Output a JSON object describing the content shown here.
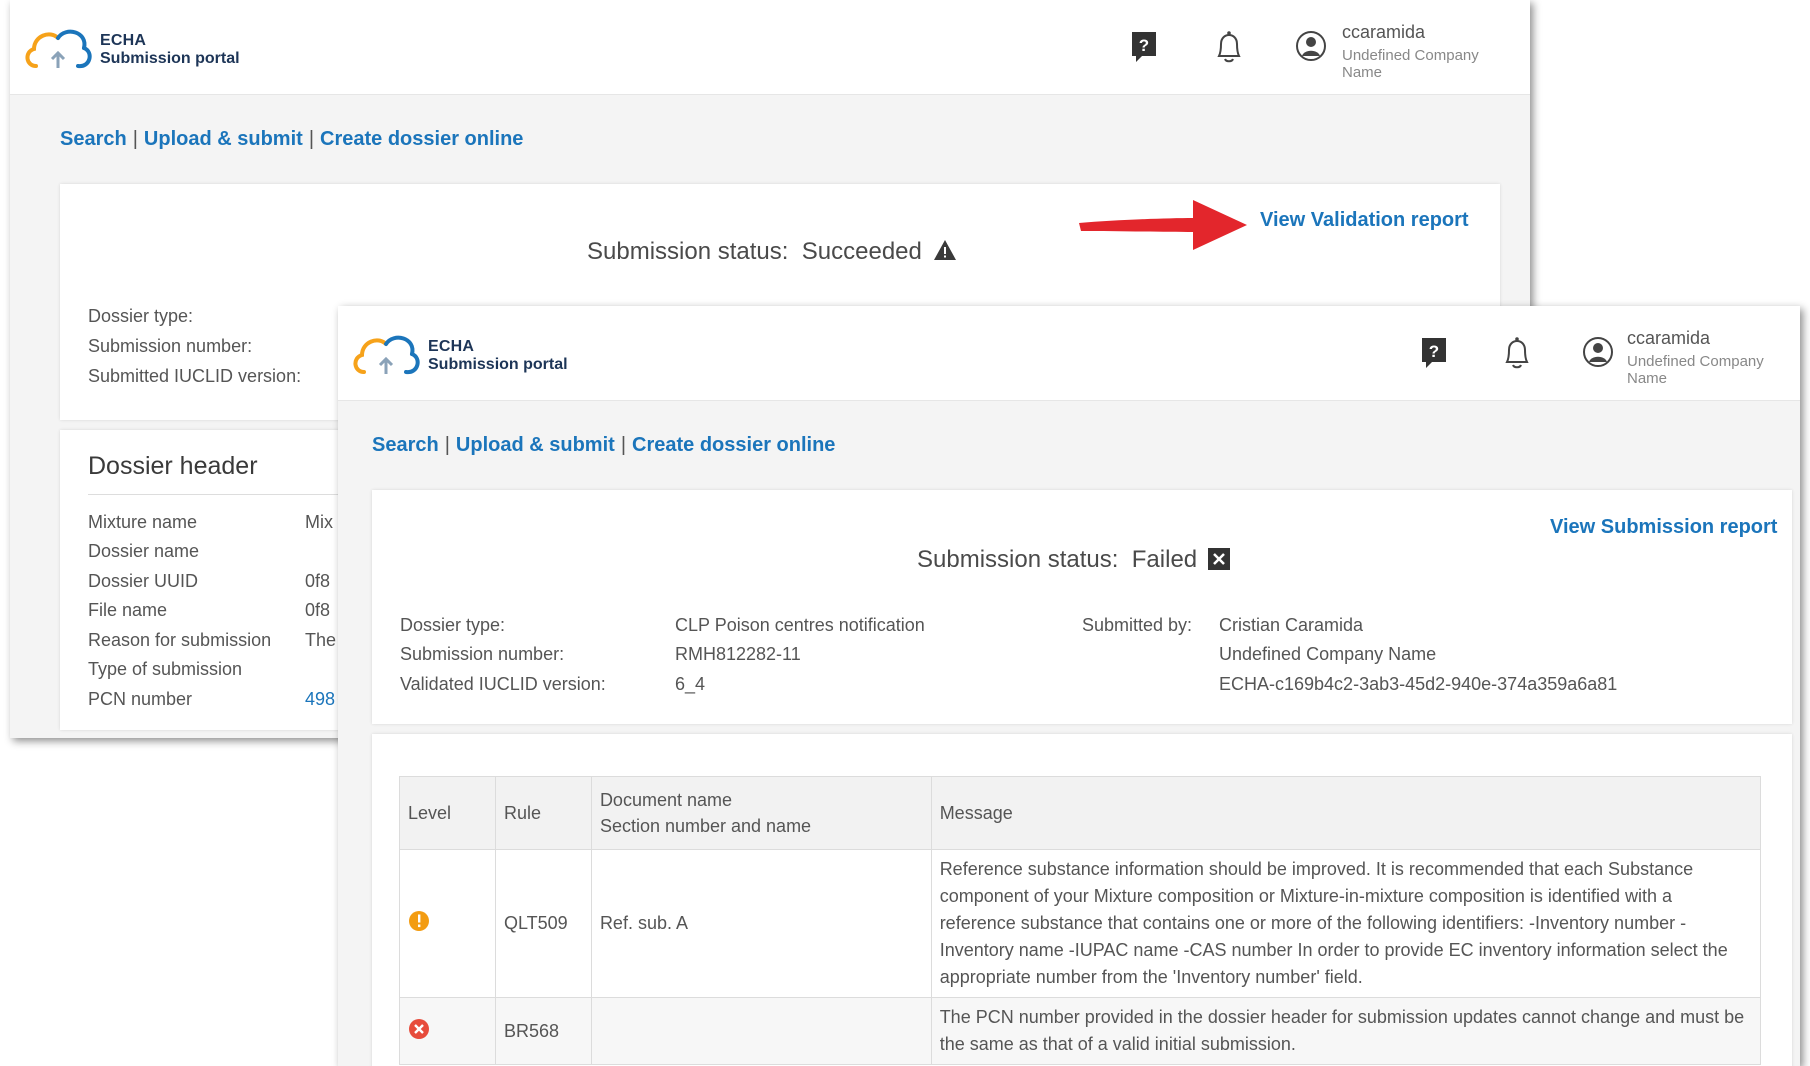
{
  "app": {
    "logo_line1": "ECHA",
    "logo_line2": "Submission portal"
  },
  "user": {
    "username": "ccaramida",
    "company_line1": "Undefined Company",
    "company_line2": "Name"
  },
  "nav": {
    "search": "Search",
    "upload_submit": "Upload & submit",
    "create_dossier": "Create dossier online",
    "separator": "|"
  },
  "window1": {
    "view_validation_report": "View Validation report",
    "status_label": "Submission status:",
    "status_value": "Succeeded",
    "summary_labels": [
      "Dossier type:",
      "Submission number:",
      "Submitted IUCLID version:"
    ],
    "dossier_header": {
      "title": "Dossier header",
      "rows": [
        {
          "label": "Mixture name",
          "value": "Mix"
        },
        {
          "label": "Dossier name",
          "value": ""
        },
        {
          "label": "Dossier UUID",
          "value": "0f8"
        },
        {
          "label": "File name",
          "value": "0f8"
        },
        {
          "label": "Reason for submission",
          "value": "The"
        },
        {
          "label": "Type of submission",
          "value": ""
        },
        {
          "label": "PCN number",
          "value": "498"
        }
      ]
    }
  },
  "window2": {
    "view_submission_report": "View Submission report",
    "status_label": "Submission status:",
    "status_value": "Failed",
    "summary": {
      "dossier_type_label": "Dossier type:",
      "dossier_type_value": "CLP Poison centres notification",
      "submission_number_label": "Submission number:",
      "submission_number_value": "RMH812282-11",
      "iuclid_label": "Validated IUCLID version:",
      "iuclid_value": "6_4",
      "submitted_by_label": "Submitted by:",
      "submitted_by_name": "Cristian Caramida",
      "submitted_by_company": "Undefined Company Name",
      "submitted_by_id": "ECHA-c169b4c2-3ab3-45d2-940e-374a359a6a81"
    },
    "table": {
      "headers": {
        "level": "Level",
        "rule": "Rule",
        "document_line1": "Document name",
        "document_line2": "Section number and name",
        "message": "Message"
      },
      "rows": [
        {
          "level": "warning",
          "rule": "QLT509",
          "document": "Ref. sub. A",
          "message": "Reference substance information should be improved. It is recommended that each Substance component of your Mixture composition or Mixture-in-mixture composition is identified with a reference substance that contains one or more of the following identifiers: -Inventory number -Inventory name -IUPAC name -CAS number In order to provide EC inventory information select the appropriate number from the 'Inventory number' field."
        },
        {
          "level": "error",
          "rule": "BR568",
          "document": "",
          "message": "The PCN number provided in the dossier header for submission updates cannot change and must be the same as that of a valid initial submission."
        }
      ]
    }
  },
  "colors": {
    "link": "#1b75bb",
    "warning": "#f39c12",
    "error": "#e74c3c",
    "arrow": "#e3262c"
  }
}
